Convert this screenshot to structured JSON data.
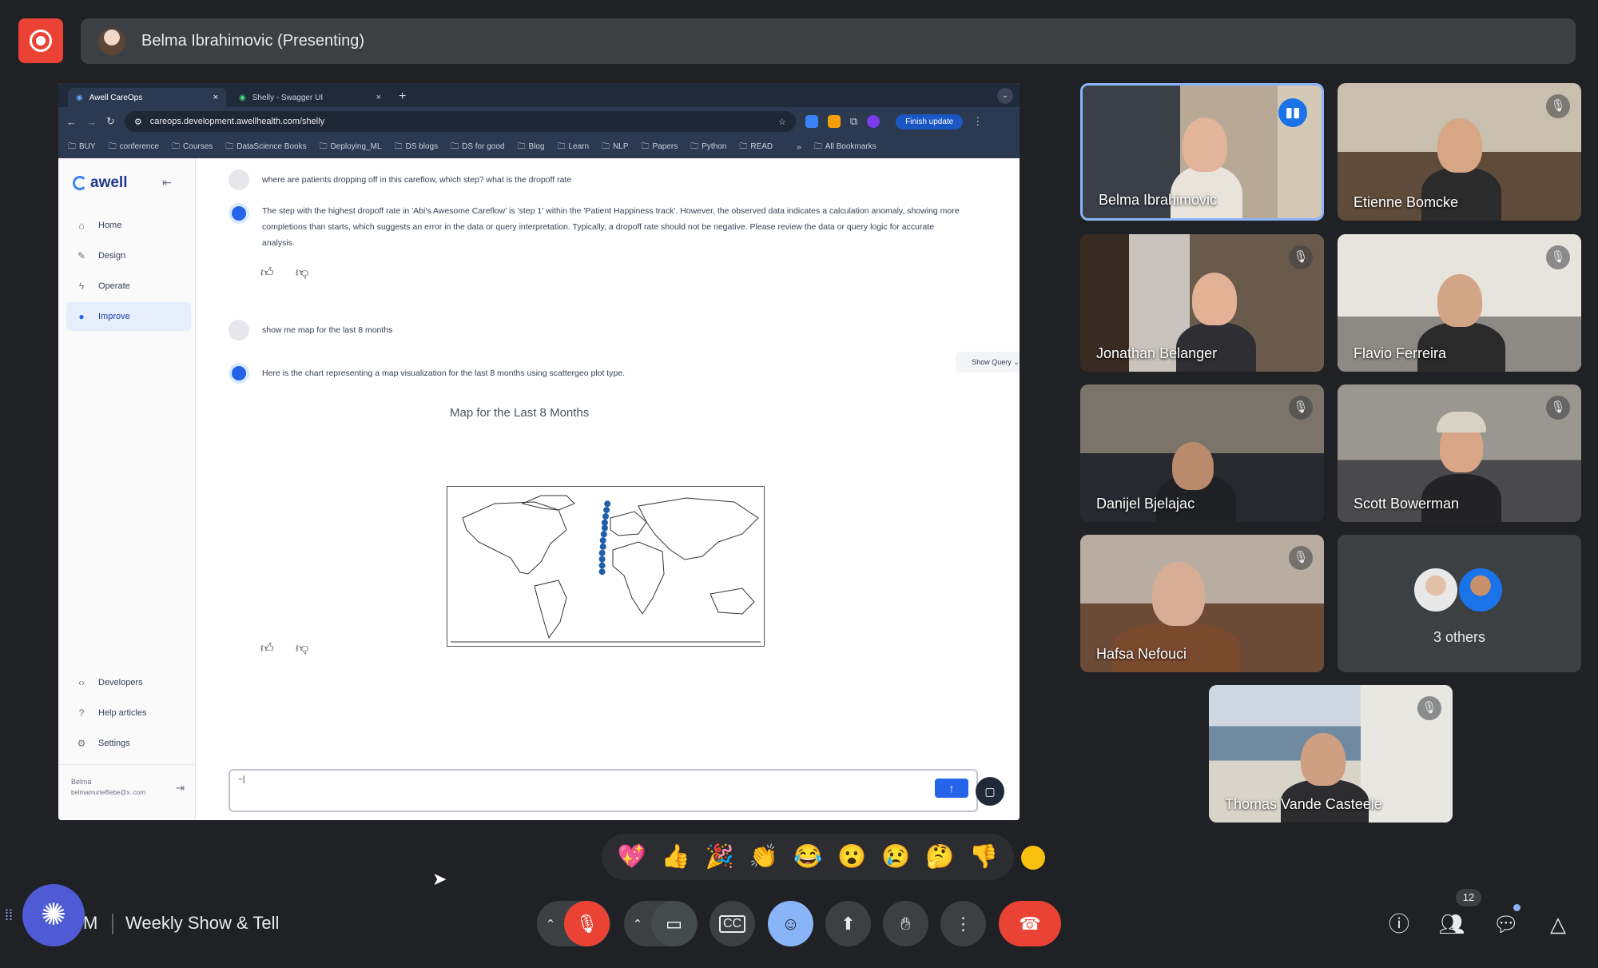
{
  "presenter": {
    "label": "Belma Ibrahimovic (Presenting)"
  },
  "browser": {
    "tabs": [
      {
        "label": "Awell CareOps",
        "close": "×"
      },
      {
        "label": "Shelly - Swagger UI",
        "close": "×"
      }
    ],
    "new_tab": "+",
    "url": "careops.development.awellhealth.com/shelly",
    "finish_update": "Finish update",
    "bookmarks": [
      "BUY",
      "conference",
      "Courses",
      "DataScience Books",
      "Deploying_ML",
      "DS blogs",
      "DS for good",
      "Blog",
      "Learn",
      "NLP",
      "Papers",
      "Python",
      "READ",
      "All Bookmarks"
    ]
  },
  "app": {
    "logo": "awell",
    "nav": [
      "Home",
      "Design",
      "Operate",
      "Improve"
    ],
    "nav_bottom": [
      "Developers",
      "Help articles",
      "Settings"
    ],
    "user_name": "Belma",
    "user_email": "belmamurtelfiebe@x..com",
    "messages": [
      {
        "role": "user",
        "text": "where are patients dropping off in this careflow, which step? what is the dropoff rate"
      },
      {
        "role": "bot",
        "text": "The step with the highest dropoff rate in 'Abi's Awesome Careflow' is 'step 1' within the 'Patient Happiness track'. However, the observed data indicates a calculation anomaly, showing more completions than starts, which suggests an error in the data or query interpretation. Typically, a dropoff rate should not be negative. Please review the data or query logic for accurate analysis."
      },
      {
        "role": "user",
        "text": "show me map for the last 8 months"
      },
      {
        "role": "bot",
        "text": "Here is the chart representing a map visualization for the last 8 months using scattergeo plot type."
      }
    ],
    "show_query": "Show Query",
    "chart_title": "Map for the Last 8 Months",
    "input_value": "~|"
  },
  "chart_data": {
    "type": "scatter",
    "title": "Map for the Last 8 Months",
    "projection": "world map (scattergeo)",
    "marker_color": "#1f5fa8",
    "points": [
      {
        "lon": 2,
        "lat": 70
      },
      {
        "lon": 1,
        "lat": 63
      },
      {
        "lon": 0,
        "lat": 56
      },
      {
        "lon": -1,
        "lat": 49
      },
      {
        "lon": -1,
        "lat": 43
      },
      {
        "lon": -2,
        "lat": 36
      },
      {
        "lon": -3,
        "lat": 29
      },
      {
        "lon": -3,
        "lat": 22
      },
      {
        "lon": -4,
        "lat": 15
      },
      {
        "lon": -4,
        "lat": 8
      },
      {
        "lon": -4,
        "lat": 1
      },
      {
        "lon": -4,
        "lat": -6
      }
    ]
  },
  "participants": [
    {
      "name": "Belma Ibrahimovic",
      "speaking": true
    },
    {
      "name": "Etienne Bomcke",
      "muted": true
    },
    {
      "name": "Jonathan Belanger",
      "muted": true
    },
    {
      "name": "Flavio Ferreira",
      "muted": true
    },
    {
      "name": "Danijel Bjelajac",
      "muted": true
    },
    {
      "name": "Scott Bowerman",
      "muted": true
    },
    {
      "name": "Hafsa Nefouci",
      "muted": true
    },
    {
      "name": "Thomas Vande Casteele",
      "muted": true
    }
  ],
  "others_label": "3 others",
  "reactions": [
    "💖",
    "👍",
    "🎉",
    "👏",
    "😂",
    "😮",
    "😢",
    "🤔",
    "👎"
  ],
  "meeting": {
    "time_suffix": "M",
    "title": "Weekly Show & Tell"
  },
  "people_count": "12",
  "colors": {
    "bg": "#202124",
    "surface": "#3c4043",
    "danger": "#ea4335",
    "accent": "#8ab4f8",
    "gemini": "#4f5bd5"
  }
}
